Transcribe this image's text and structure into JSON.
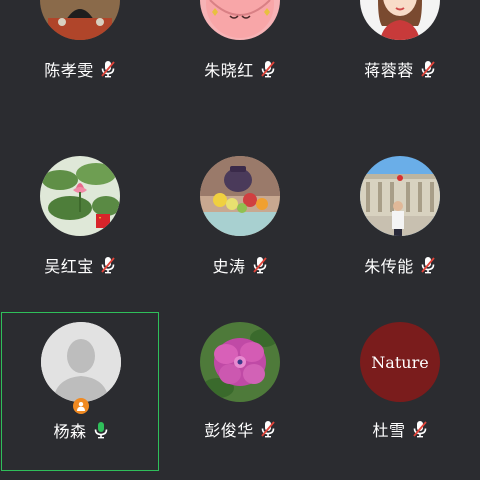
{
  "participants": [
    {
      "name": "陈孝雯",
      "mic": "muted",
      "avatar": "photo-woman-tea"
    },
    {
      "name": "朱晓红",
      "mic": "muted",
      "avatar": "peach-cartoon"
    },
    {
      "name": "蒋蓉蓉",
      "mic": "muted",
      "avatar": "cartoon-girl"
    },
    {
      "name": "吴红宝",
      "mic": "muted",
      "avatar": "lotus-flowers"
    },
    {
      "name": "史涛",
      "mic": "muted",
      "avatar": "teapot-fruit"
    },
    {
      "name": "朱传能",
      "mic": "muted",
      "avatar": "man-at-building"
    },
    {
      "name": "杨森",
      "mic": "active",
      "avatar": "default-person",
      "host": true,
      "active_speaker": true
    },
    {
      "name": "彭俊华",
      "mic": "muted",
      "avatar": "purple-hydrangea"
    },
    {
      "name": "杜雪",
      "mic": "muted",
      "avatar": "nature-text"
    }
  ],
  "nature_avatar_text": "Nature",
  "colors": {
    "background": "#2b2c30",
    "active_border": "#2fbf5a",
    "mic_active": "#2fbf5a",
    "mic_muted_slash": "#e0443a",
    "host_badge": "#f08a22",
    "nature_bg": "#7a1c1c"
  }
}
